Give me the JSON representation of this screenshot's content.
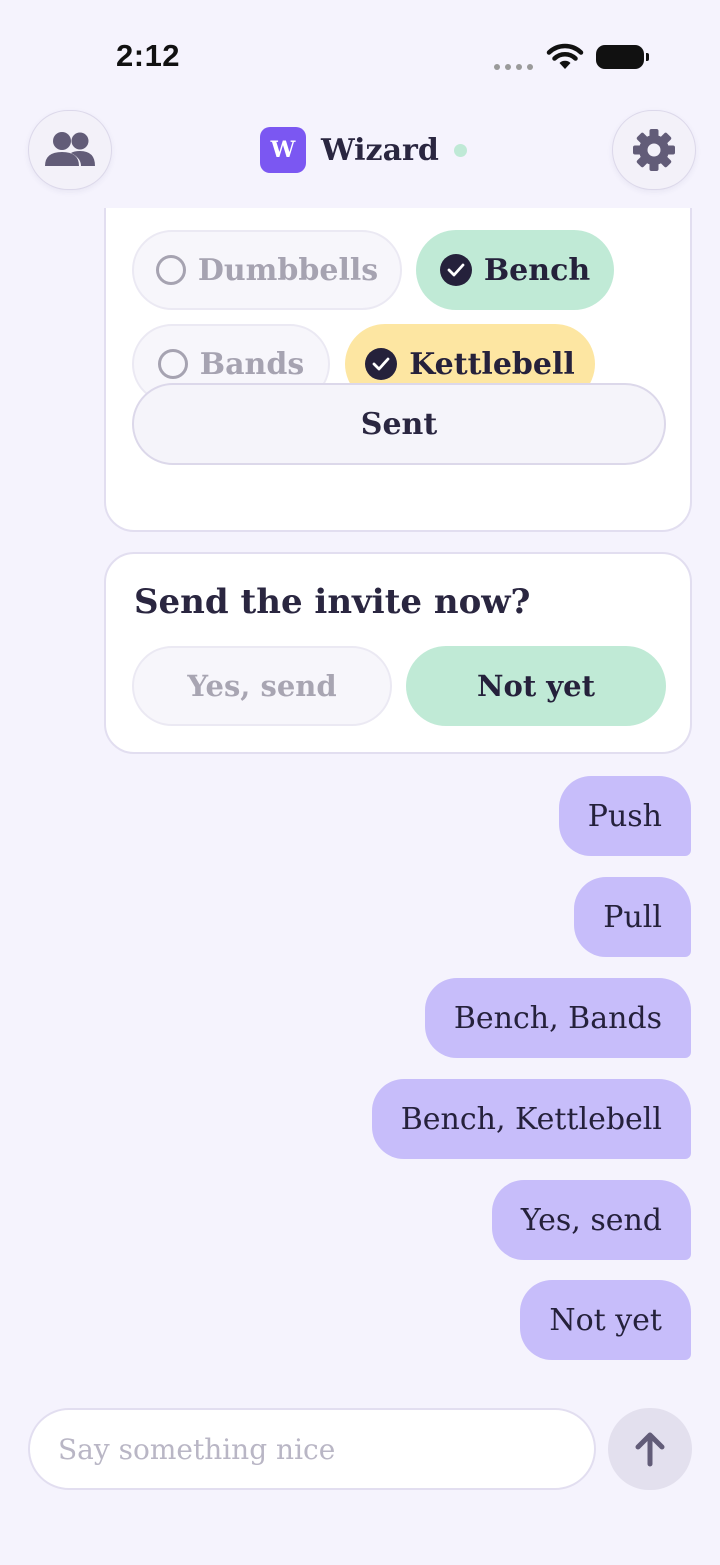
{
  "status_bar": {
    "time": "2:12"
  },
  "header": {
    "brand_initial": "W",
    "brand_name": "Wizard",
    "people_icon": "people-icon",
    "settings_icon": "gear-icon",
    "online_color": "#bfe9d6"
  },
  "equipment_card": {
    "options": [
      {
        "label": "Dumbbells",
        "selected": false
      },
      {
        "label": "Bench",
        "selected": true,
        "color": "#c0ead6"
      },
      {
        "label": "Bands",
        "selected": false
      },
      {
        "label": "Kettlebell",
        "selected": true,
        "color": "#fde6a2"
      }
    ],
    "submit_label": "Sent"
  },
  "invite_card": {
    "question": "Send the invite now?",
    "yes_label": "Yes, send",
    "no_label": "Not yet"
  },
  "user_messages": [
    "Push",
    "Pull",
    "Bench, Bands",
    "Bench, Kettlebell",
    "Yes, send",
    "Not yet"
  ],
  "composer": {
    "placeholder": "Say something nice",
    "send_icon": "arrow-up-icon"
  },
  "colors": {
    "background": "#f5f3fd",
    "accent": "#7b57f2",
    "bubble": "#c7bdfa"
  }
}
